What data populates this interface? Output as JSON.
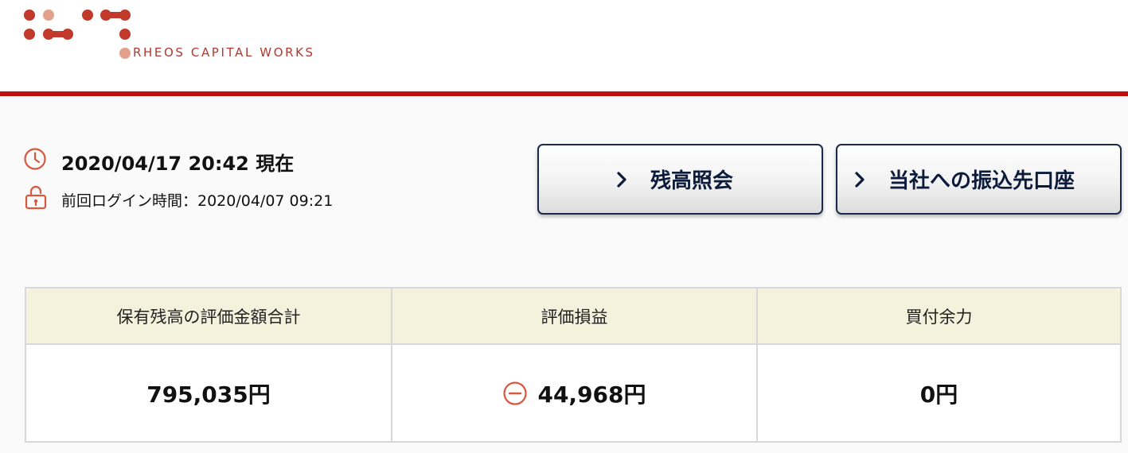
{
  "brand": {
    "name": "RHEOS CAPITAL WORKS",
    "color": "#b4372e",
    "light_color": "#e3a08a"
  },
  "status": {
    "datetime": "2020/04/17 20:42 現在",
    "last_login": "前回ログイン時間：2020/04/07 09:21"
  },
  "nav": {
    "balance_label": "残高照会",
    "transfer_label": "当社への振込先口座"
  },
  "summary": {
    "headers": [
      "保有残高の評価金額合計",
      "評価損益",
      "買付余力"
    ],
    "values": [
      "795,035円",
      "44,968円",
      "0円"
    ],
    "pnl_sign": "negative"
  },
  "icons": [
    "clock-icon",
    "unlock-icon",
    "chevron-right-icon",
    "minus-circle-icon"
  ],
  "colors": {
    "accent_red": "#c00d0d",
    "navy": "#0c1b3a",
    "header_cell_bg": "#f4f1dd",
    "icon_orange": "#d9573f"
  }
}
